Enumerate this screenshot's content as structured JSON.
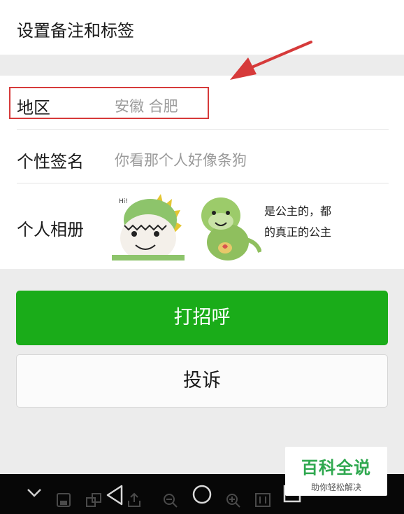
{
  "remark": {
    "label": "设置备注和标签"
  },
  "info": {
    "region": {
      "label": "地区",
      "value": "安徽  合肥"
    },
    "signature": {
      "label": "个性签名",
      "value": "你看那个人好像条狗"
    },
    "album": {
      "label": "个人相册",
      "caption_lines": [
        "是公主的，都",
        "的真正的公主"
      ],
      "sticker_text": "Hi!"
    }
  },
  "buttons": {
    "greet": "打招呼",
    "report": "投诉"
  },
  "watermark": {
    "title": "百科全说",
    "subtitle": "助你轻松解决"
  },
  "colors": {
    "accent": "#1aac19",
    "highlight": "#d63a3a",
    "watermark_green": "#2fa84f"
  },
  "icons": [
    "chevron-down-icon",
    "save-icon",
    "screen-capture-icon",
    "share-icon",
    "back-icon",
    "home-icon",
    "zoom-out-icon",
    "zoom-in-icon",
    "recents-icon"
  ]
}
